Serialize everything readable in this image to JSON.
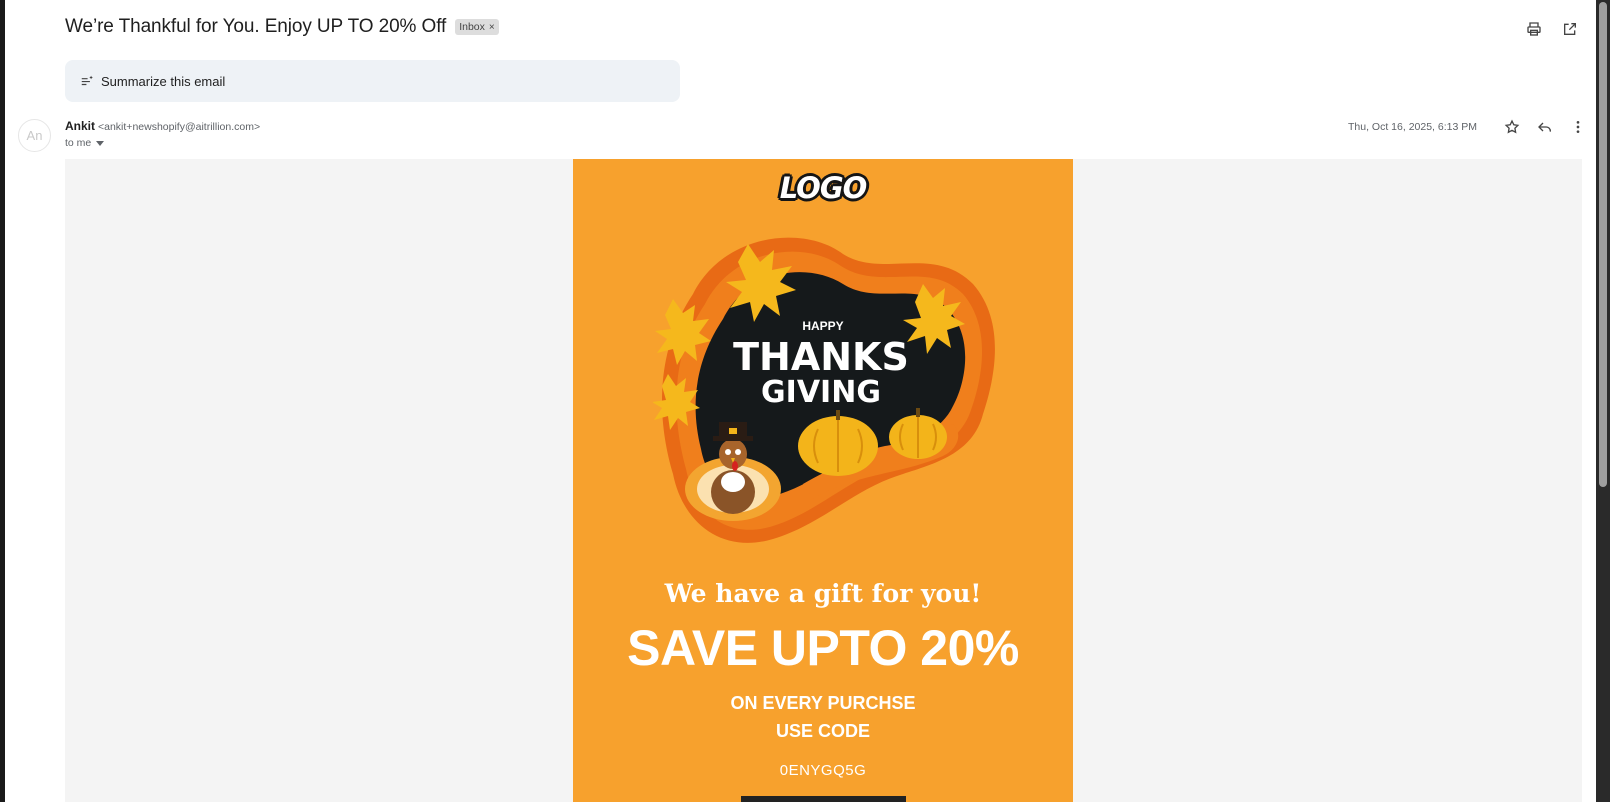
{
  "email": {
    "subject": "We’re Thankful for You. Enjoy UP TO 20% Off",
    "label": "Inbox",
    "label_remove": "×",
    "summarize_label": "Summarize this email",
    "avatar_initials": "An",
    "sender_name": "Ankit",
    "sender_email": "<ankit+newshopify@aitrillion.com>",
    "recipient": "to me",
    "date": "Thu, Oct 16, 2025, 6:13 PM"
  },
  "actions": {
    "top": [
      "printer-icon",
      "open-new-window-icon"
    ],
    "message": [
      "star-icon",
      "reply-icon",
      "more-vertical-icon"
    ]
  },
  "content": {
    "logo_text": "LOGO",
    "hero": {
      "line1": "HAPPY",
      "line2": "THANKS",
      "line3": "GIVING"
    },
    "gift_text": "We have a gift for you!",
    "headline": "SAVE UPTO 20%",
    "subline1": "ON EVERY PURCHSE",
    "subline2": "USE CODE",
    "code": "0ENYGQ5G"
  },
  "colors": {
    "card_orange": "#f7a12d",
    "hero_dark": "#15191b",
    "leaf_yellow": "#f5b81c",
    "pumpkin": "#f3b41a",
    "body_bg": "#f4f4f4"
  }
}
